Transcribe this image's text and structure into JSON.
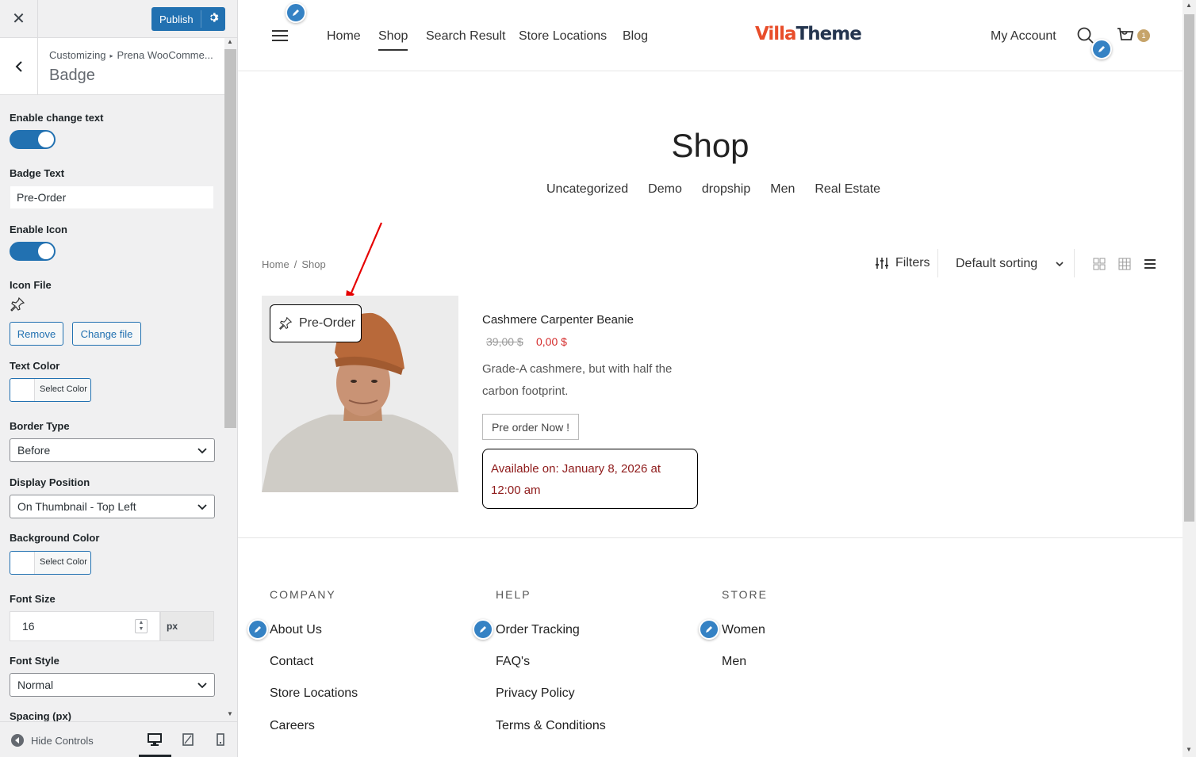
{
  "customizer": {
    "close_label": "✕",
    "publish_label": "Publish",
    "breadcrumb": [
      "Customizing",
      "Prena WooComme..."
    ],
    "section_title": "Badge",
    "hide_controls_label": "Hide Controls",
    "controls": {
      "enable_change_text": {
        "label": "Enable change text",
        "value": true
      },
      "badge_text": {
        "label": "Badge Text",
        "value": "Pre-Order"
      },
      "enable_icon": {
        "label": "Enable Icon",
        "value": true
      },
      "icon_file": {
        "label": "Icon File",
        "remove_label": "Remove",
        "change_label": "Change file"
      },
      "text_color": {
        "label": "Text Color",
        "button_label": "Select Color"
      },
      "border_type": {
        "label": "Border Type",
        "value": "Before"
      },
      "display_position": {
        "label": "Display Position",
        "value": "On Thumbnail - Top Left"
      },
      "background_color": {
        "label": "Background Color",
        "button_label": "Select Color"
      },
      "font_size": {
        "label": "Font Size",
        "value": "16",
        "unit": "px"
      },
      "font_style": {
        "label": "Font Style",
        "value": "Normal"
      },
      "spacing": {
        "label": "Spacing (px)"
      }
    }
  },
  "site": {
    "nav": [
      "Home",
      "Shop",
      "Search Result",
      "Store Locations",
      "Blog"
    ],
    "active_nav": "Shop",
    "logo": {
      "part1": "Villa",
      "part2": "Theme"
    },
    "my_account": "My Account",
    "cart_count": "1",
    "page_title": "Shop",
    "categories": [
      "Uncategorized",
      "Demo",
      "dropship",
      "Men",
      "Real Estate"
    ],
    "breadcrumb": [
      "Home",
      "Shop"
    ],
    "filters_label": "Filters",
    "sorting_label": "Default sorting",
    "product": {
      "badge": "Pre-Order",
      "name": "Cashmere Carpenter Beanie",
      "old_price": "39,00 $",
      "price": "0,00 $",
      "description": "Grade-A cashmere, but with half the carbon footprint.",
      "button": "Pre order Now !",
      "availability": "Available on: January 8, 2026 at 12:00 am"
    },
    "footer": {
      "company": {
        "title": "COMPANY",
        "links": [
          "About Us",
          "Contact",
          "Store Locations",
          "Careers"
        ]
      },
      "help": {
        "title": "HELP",
        "links": [
          "Order Tracking",
          "FAQ's",
          "Privacy Policy",
          "Terms & Conditions"
        ]
      },
      "store": {
        "title": "STORE",
        "links": [
          "Women",
          "Men"
        ]
      }
    }
  },
  "colors": {
    "accent": "#2271b1",
    "sale": "#d42b2b",
    "availability": "#8e1a1a",
    "logo_orange": "#e84d2a",
    "logo_navy": "#24354f"
  }
}
